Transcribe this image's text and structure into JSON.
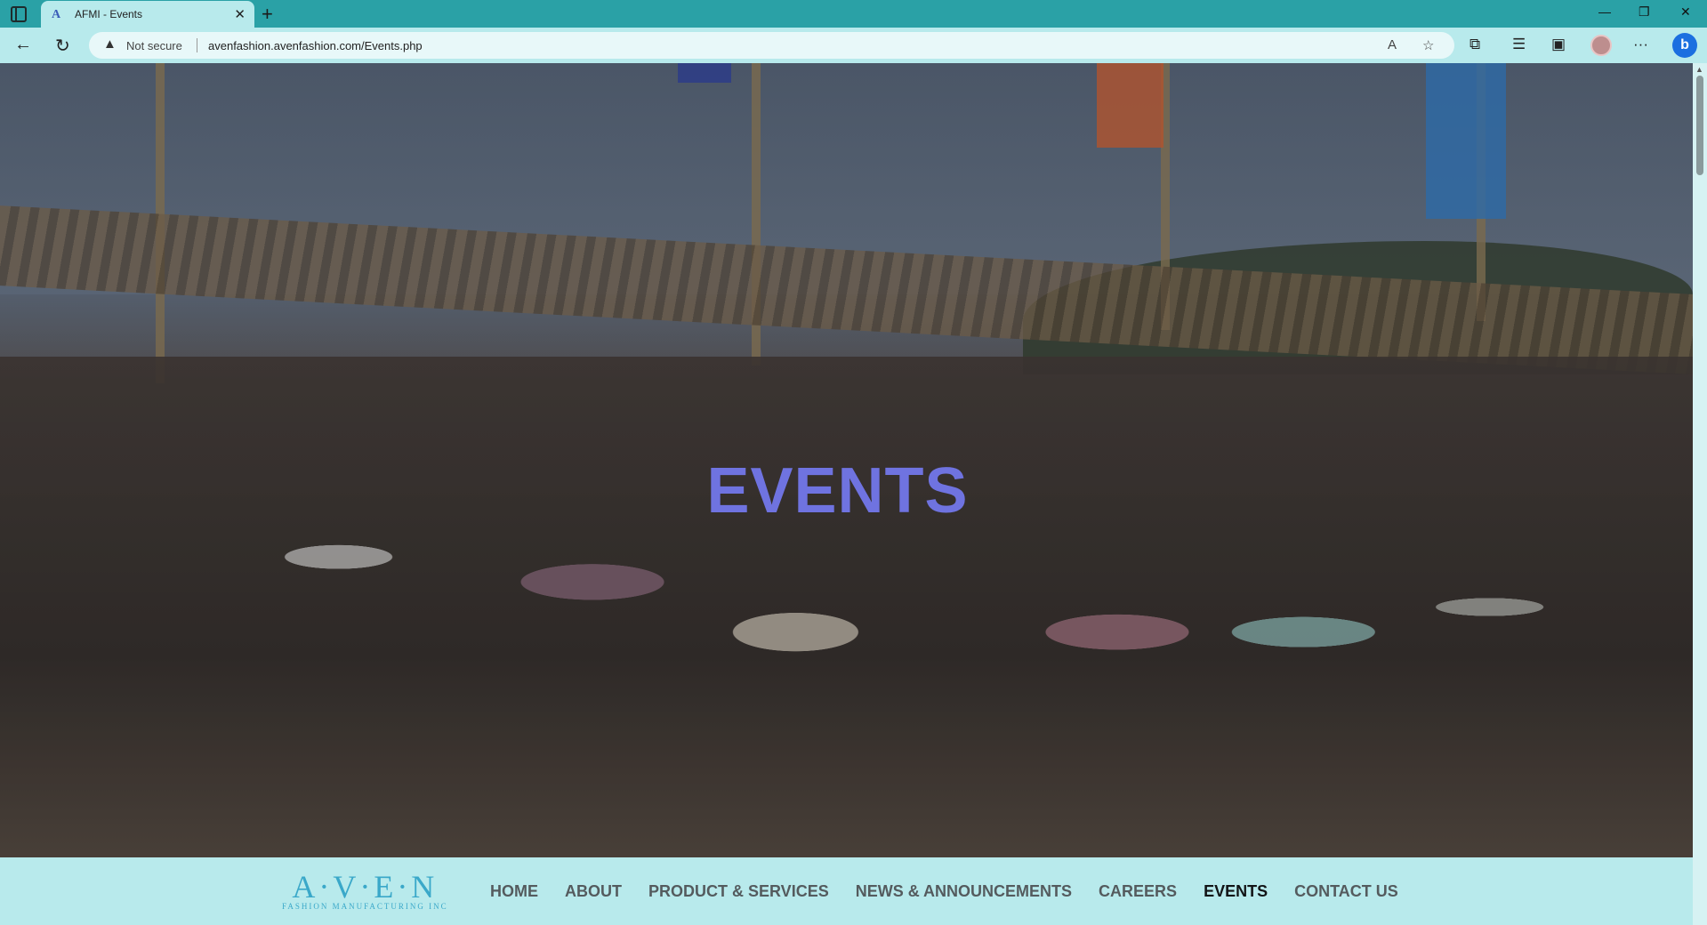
{
  "browser": {
    "tab_title": "AFMI - Events",
    "tab_favicon": "A",
    "new_tab_symbol": "+",
    "not_secure_label": "Not secure",
    "url": "avenfashion.avenfashion.com/Events.php",
    "icons": [
      "sidebar-toggle-icon",
      "back-arrow-icon",
      "refresh-icon",
      "warning-icon",
      "read-aloud-icon",
      "favorite-star-icon",
      "extensions-icon",
      "favorites-icon",
      "collections-icon",
      "profile-icon",
      "more-icon",
      "bing-icon"
    ]
  },
  "hero": {
    "title": "EVENTS",
    "title_color": "#6f73e0"
  },
  "site_nav": {
    "logo_main": "A·V·E·N",
    "logo_sub": "FASHION MANUFACTURING INC",
    "items": [
      {
        "label": "HOME",
        "active": false
      },
      {
        "label": "ABOUT",
        "active": false
      },
      {
        "label": "PRODUCT & SERVICES",
        "active": false
      },
      {
        "label": "NEWS & ANNOUNCEMENTS",
        "active": false
      },
      {
        "label": "CAREERS",
        "active": false
      },
      {
        "label": "EVENTS",
        "active": true
      },
      {
        "label": "CONTACT US",
        "active": false
      }
    ]
  },
  "colors": {
    "browser_chrome": "#2aa1a6",
    "toolbar": "#b8eaec",
    "logo": "#3aa8c9"
  }
}
